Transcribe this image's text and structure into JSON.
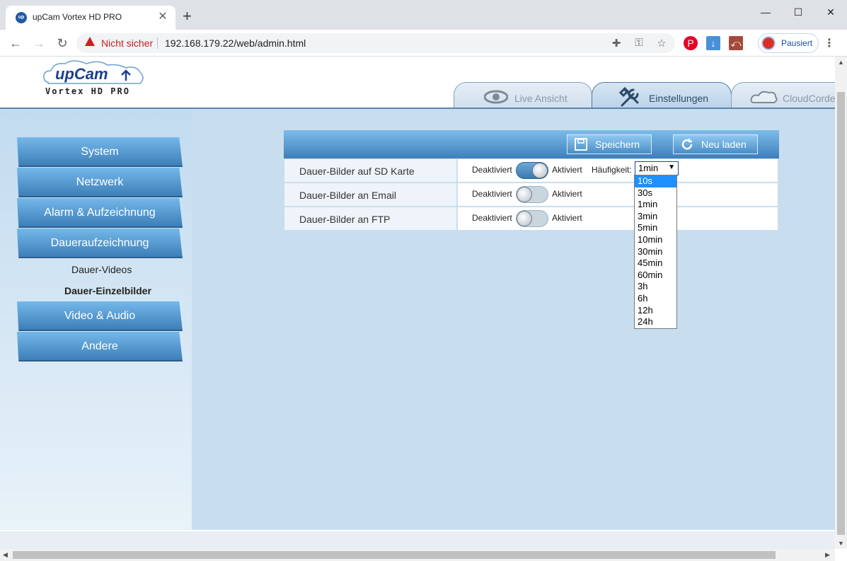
{
  "browser": {
    "tab_title": "upCam Vortex HD PRO",
    "favicon_text": "up",
    "security_label": "Nicht sicher",
    "url": "192.168.179.22/web/admin.html",
    "profile_label": "Pausiert",
    "icons": [
      "back-icon",
      "forward-icon",
      "reload-icon",
      "warning-icon",
      "extension-icon",
      "key-icon",
      "star-icon",
      "pinterest-icon",
      "download-icon",
      "pdf-icon",
      "menu-icon"
    ]
  },
  "logo": {
    "brand": "upCam",
    "model": "Vortex HD PRO"
  },
  "top_tabs": [
    {
      "label": "Live Ansicht",
      "icon": "eye-icon",
      "active": false
    },
    {
      "label": "Einstellungen",
      "icon": "tools-icon",
      "active": true
    },
    {
      "label": "CloudCorder",
      "icon": "cloud-icon",
      "active": false
    }
  ],
  "sidebar": {
    "items": [
      {
        "label": "System"
      },
      {
        "label": "Netzwerk"
      },
      {
        "label": "Alarm & Aufzeichnung"
      },
      {
        "label": "Daueraufzeichnung"
      },
      {
        "label": "Video & Audio"
      },
      {
        "label": "Andere"
      }
    ],
    "subitems": [
      {
        "label": "Dauer-Videos",
        "active": false
      },
      {
        "label": "Dauer-Einzelbilder",
        "active": true
      }
    ]
  },
  "panel": {
    "save_label": "Speichern",
    "reload_label": "Neu laden",
    "rows": [
      {
        "label": "Dauer-Bilder auf SD Karte",
        "off_label": "Deaktiviert",
        "on_label": "Aktiviert",
        "enabled": true
      },
      {
        "label": "Dauer-Bilder an Email",
        "off_label": "Deaktiviert",
        "on_label": "Aktiviert",
        "enabled": false
      },
      {
        "label": "Dauer-Bilder an FTP",
        "off_label": "Deaktiviert",
        "on_label": "Aktiviert",
        "enabled": false
      }
    ],
    "frequency": {
      "label": "Häufigkeit:",
      "value": "1min",
      "options": [
        "10s",
        "30s",
        "1min",
        "3min",
        "5min",
        "10min",
        "30min",
        "45min",
        "60min",
        "3h",
        "6h",
        "12h",
        "24h"
      ],
      "highlighted": "10s"
    }
  },
  "colors": {
    "accent": "#3e7fba",
    "tab_active": "#b9d2e8",
    "highlight": "#1e90ff"
  }
}
